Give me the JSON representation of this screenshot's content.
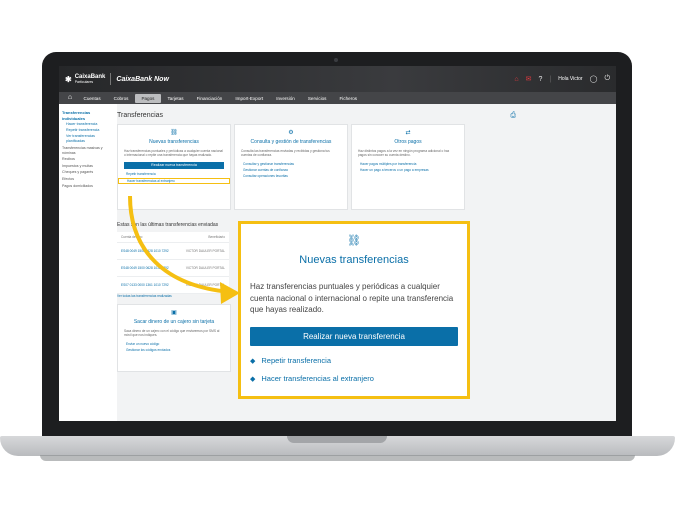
{
  "header": {
    "bank_name": "CaixaBank",
    "bank_sub": "Particulares",
    "brand": "CaixaBank Now",
    "greeting": "Hola Victor",
    "notifications_icon": "bell-icon",
    "mail_icon": "mail-icon",
    "help_icon": "help-icon",
    "user_icon": "user-icon",
    "power_icon": "power-icon"
  },
  "nav": {
    "home_icon": "home-icon",
    "items": [
      "Cuentas",
      "Cobros",
      "Pagos",
      "Tarjetas",
      "Financiación",
      "Import-Export",
      "Inversión",
      "Servicios",
      "Ficheros"
    ],
    "active": "Pagos"
  },
  "sidebar": {
    "heading": "Transferencias individuales",
    "links": [
      "Hacer transferencia",
      "Repetir transferencia",
      "Ver transferencias planificadas"
    ],
    "items": [
      "Transferencias masivas y nóminas",
      "Recibos",
      "Impuestos y multas",
      "Cheques y pagarés",
      "Efectos",
      "Pagos domiciliados"
    ]
  },
  "page": {
    "title": "Transferencias",
    "print_icon": "print-icon"
  },
  "cards": {
    "nuevas": {
      "title": "Nuevas transferencias",
      "desc": "Haz transferencias puntuales y periódicas a cualquier cuenta nacional o internacional o repite una transferencia que hayas realizado.",
      "button": "Realizar nueva transferencia",
      "link1": "Repetir transferencia",
      "link2": "Hacer transferencias al extranjero"
    },
    "consulta": {
      "title": "Consulta y gestión de transferencias",
      "desc": "Consulta las transferencias enviadas y recibidas y gestiona tus cuentas de confianza.",
      "link1": "Consultar y gestionar transferencias",
      "link2": "Gestionar cuentas de confianza",
      "link3": "Consultar operaciones favoritas"
    },
    "otros": {
      "title": "Otros pagos",
      "desc": "Haz distintos pagos a la vez en ningún programa adicional o haz pagos sin conocer su cuenta destino.",
      "link1": "Hacer pagos múltiples por transferencia",
      "link2": "Hacer un pago a terceros o un pago a empresas"
    }
  },
  "recent": {
    "title": "Estas son las últimas transferencias enviadas",
    "col_account": "Cuenta destino",
    "col_beneficiary": "Beneficiario",
    "rows": [
      {
        "account": "ES48 0049 1500 0628 1010 7292",
        "beneficiary": "VICTOR DAULER PORTAL"
      },
      {
        "account": "ES48 0049 1500 0628 1010 7292",
        "beneficiary": "VICTOR DAULER PORTAL"
      },
      {
        "account": "ES07 0133 0000 1361 1010 7292",
        "beneficiary": "VICTOR DAULER PORTAL"
      }
    ],
    "all_link": "Ver todas las transferencias realizadas"
  },
  "cash_card": {
    "title": "Sacar dinero de un cajero sin tarjeta",
    "desc": "Saca dinero de un cajero con el código que enviaremos por SMS al móvil que nos indiques.",
    "link1": "Enviar un nuevo código",
    "link2": "Gestionar los códigos enviados"
  },
  "callout": {
    "title": "Nuevas transferencias",
    "desc": "Haz transferencias puntuales y periódicas a cualquier cuenta nacional o internacional o repite una transferencia que hayas realizado.",
    "button": "Realizar nueva transferencia",
    "link1": "Repetir transferencia",
    "link2": "Hacer transferencias al extranjero",
    "highlight_color": "#f5bf12",
    "accent_color": "#0a6fa8"
  }
}
